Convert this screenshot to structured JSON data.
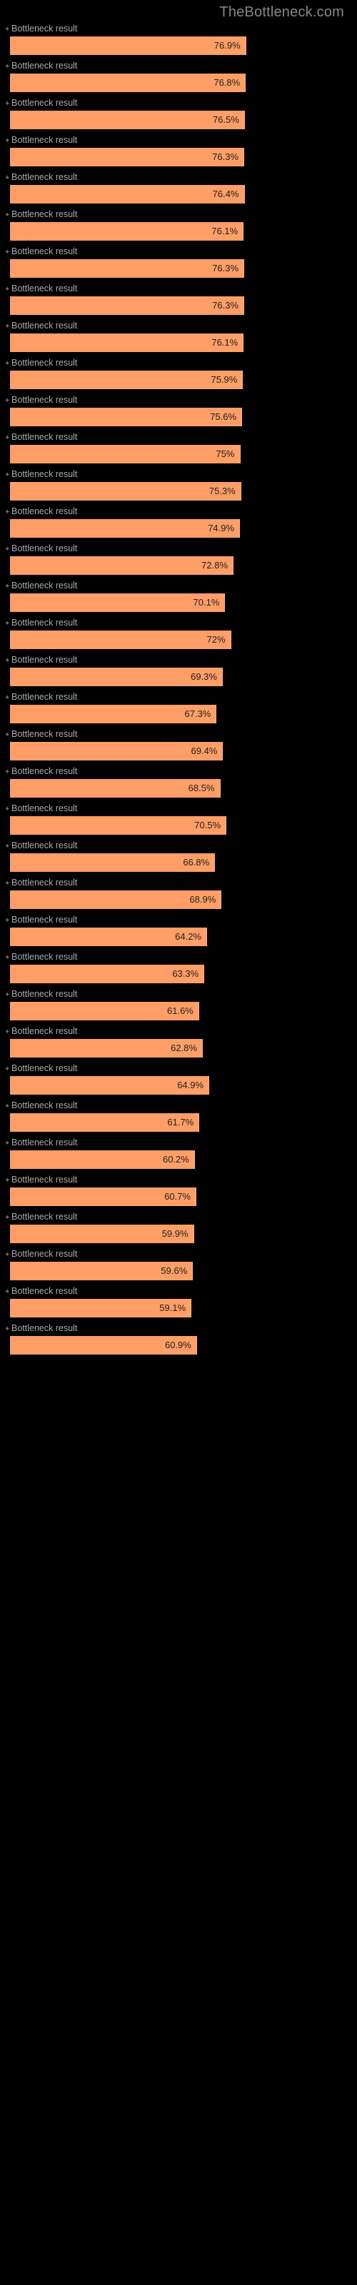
{
  "header": {
    "site_title": "TheBottleneck.com"
  },
  "chart_data": {
    "type": "bar",
    "categories": [
      "Bottleneck result",
      "Bottleneck result",
      "Bottleneck result",
      "Bottleneck result",
      "Bottleneck result",
      "Bottleneck result",
      "Bottleneck result",
      "Bottleneck result",
      "Bottleneck result",
      "Bottleneck result",
      "Bottleneck result",
      "Bottleneck result",
      "Bottleneck result",
      "Bottleneck result",
      "Bottleneck result",
      "Bottleneck result",
      "Bottleneck result",
      "Bottleneck result",
      "Bottleneck result",
      "Bottleneck result",
      "Bottleneck result",
      "Bottleneck result",
      "Bottleneck result",
      "Bottleneck result",
      "Bottleneck result",
      "Bottleneck result",
      "Bottleneck result",
      "Bottleneck result",
      "Bottleneck result",
      "Bottleneck result",
      "Bottleneck result",
      "Bottleneck result",
      "Bottleneck result",
      "Bottleneck result",
      "Bottleneck result",
      "Bottleneck result"
    ],
    "values": [
      76.9,
      76.8,
      76.5,
      76.3,
      76.4,
      76.1,
      76.3,
      76.3,
      76.1,
      75.9,
      75.6,
      75.0,
      75.3,
      74.9,
      72.8,
      70.1,
      72.0,
      69.3,
      67.3,
      69.4,
      68.5,
      70.5,
      66.8,
      68.9,
      64.2,
      63.3,
      61.6,
      62.8,
      64.9,
      61.7,
      60.2,
      60.7,
      59.9,
      59.6,
      59.1,
      60.9
    ],
    "value_labels": [
      "76.9%",
      "76.8%",
      "76.5%",
      "76.3%",
      "76.4%",
      "76.1%",
      "76.3%",
      "76.3%",
      "76.1%",
      "75.9%",
      "75.6%",
      "75%",
      "75.3%",
      "74.9%",
      "72.8%",
      "70.1%",
      "72%",
      "69.3%",
      "67.3%",
      "69.4%",
      "68.5%",
      "70.5%",
      "66.8%",
      "68.9%",
      "64.2%",
      "63.3%",
      "61.6%",
      "62.8%",
      "64.9%",
      "61.7%",
      "60.2%",
      "60.7%",
      "59.9%",
      "59.6%",
      "59.1%",
      "60.9%"
    ],
    "xlabel": "",
    "ylabel": "",
    "xlim": [
      0,
      100
    ],
    "title": "",
    "bar_color": "#ff9e66",
    "text_color": "#aaaaaa",
    "background": "#000000"
  }
}
